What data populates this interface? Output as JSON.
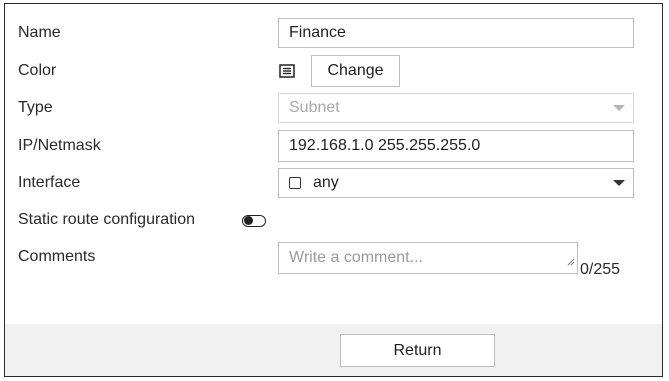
{
  "form": {
    "name": {
      "label": "Name",
      "value": "Finance"
    },
    "color": {
      "label": "Color",
      "button": "Change",
      "icon": "color-swatch-icon"
    },
    "type": {
      "label": "Type",
      "value": "Subnet"
    },
    "ip": {
      "label": "IP/Netmask",
      "value": "192.168.1.0 255.255.255.0"
    },
    "interface": {
      "label": "Interface",
      "value": "any"
    },
    "static_route": {
      "label": "Static route configuration",
      "enabled": false
    },
    "comments": {
      "label": "Comments",
      "placeholder": "Write a comment...",
      "counter": "0/255"
    }
  },
  "footer": {
    "return_label": "Return"
  }
}
